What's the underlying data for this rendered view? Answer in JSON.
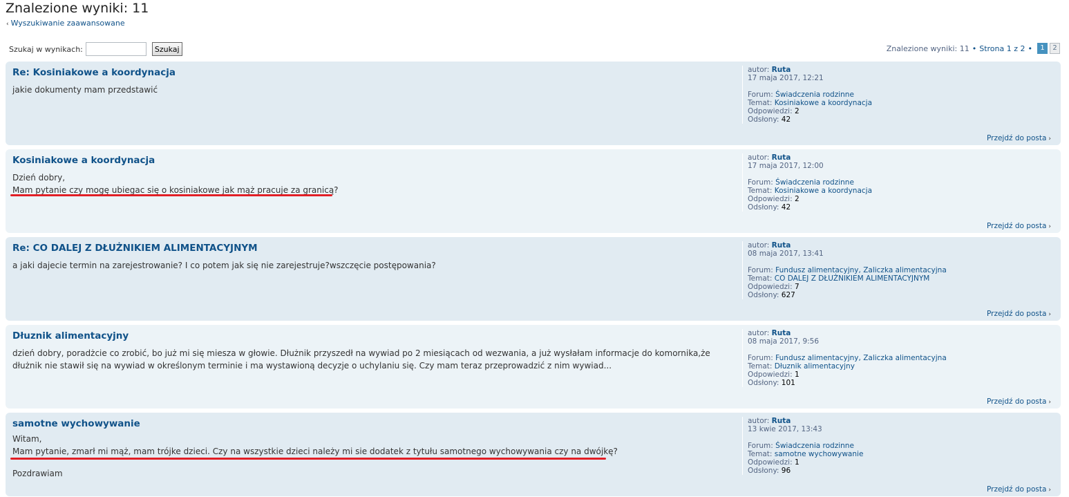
{
  "header": {
    "title": "Znalezione wyniki: 11",
    "advanced_search": "Wyszukiwanie zaawansowane"
  },
  "search": {
    "label": "Szukaj w wynikach:",
    "value": "",
    "button": "Szukaj"
  },
  "pagination": {
    "results": "Znalezione wyniki: 11",
    "page_of": "Strona 1 z 2",
    "pages": [
      "1",
      "2"
    ],
    "current": "1"
  },
  "labels": {
    "author": "autor:",
    "forum": "Forum:",
    "topic": "Temat:",
    "replies": "Odpowiedzi:",
    "views": "Odsłony:",
    "goto": "Przejdź do posta"
  },
  "posts": [
    {
      "title": "Re: Kosiniakowe a koordynacja",
      "lines": [
        "jakie dokumenty mam przedstawić"
      ],
      "author": "Ruta",
      "date": "17 maja 2017, 12:21",
      "forum": "Świadczenia rodzinne",
      "topic": "Kosiniakowe a koordynacja",
      "replies": "2",
      "views": "42"
    },
    {
      "title": "Kosiniakowe a koordynacja",
      "lines": [
        "Dzień dobry,",
        "Mam pytanie czy mogę ubiegac się o kosiniakowe jak mąż pracuje za granicą?"
      ],
      "author": "Ruta",
      "date": "17 maja 2017, 12:00",
      "forum": "Świadczenia rodzinne",
      "topic": "Kosiniakowe a koordynacja",
      "replies": "2",
      "views": "42"
    },
    {
      "title": "Re: CO DALEJ Z DŁUŻNIKIEM ALIMENTACYJNYM",
      "lines": [
        "a jaki dajecie termin na zarejestrowanie? I co potem jak się nie zarejestruje?wszczęcie postępowania?"
      ],
      "author": "Ruta",
      "date": "08 maja 2017, 13:41",
      "forum": "Fundusz alimentacyjny, Zaliczka alimentacyjna",
      "topic": "CO DALEJ Z DŁUŻNIKIEM ALIMENTACYJNYM",
      "replies": "7",
      "views": "627"
    },
    {
      "title": "Dłuznik alimentacyjny",
      "lines": [
        "dzień dobry, poradżcie co zrobić, bo już mi się miesza w głowie. Dłużnik przyszedł na wywiad po 2 miesiącach od wezwania, a już wysłałam informacje do komornika,że",
        "dłużnik nie stawił się na wywiad w określonym terminie i ma wystawioną decyzje o uchylaniu się. Czy mam teraz przeprowadzić z nim wywiad..."
      ],
      "author": "Ruta",
      "date": "08 maja 2017, 9:56",
      "forum": "Fundusz alimentacyjny, Zaliczka alimentacyjna",
      "topic": "Dłuznik alimentacyjny",
      "replies": "1",
      "views": "101"
    },
    {
      "title": "samotne wychowywanie",
      "lines": [
        "Witam,",
        "Mam pytanie, zmarł mi mąż, mam trójke dzieci. Czy na wszystkie dzieci należy mi sie dodatek z tytułu samotnego wychowywania czy na dwójkę?",
        "",
        "Pozdrawiam"
      ],
      "author": "Ruta",
      "date": "13 kwie 2017, 13:43",
      "forum": "Świadczenia rodzinne",
      "topic": "samotne wychowywanie",
      "replies": "1",
      "views": "96"
    }
  ],
  "colors": {
    "link": "#105289",
    "post_bg_dark": "#e1ebf2",
    "post_bg_light": "#ecf3f7",
    "annotation": "#e21f26"
  }
}
